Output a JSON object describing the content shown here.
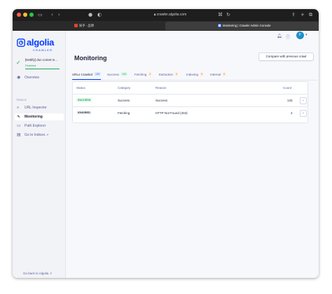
{
  "browser": {
    "url": "crawler.algolia.com",
    "tabs": [
      {
        "title": "知乎 - 品牌"
      },
      {
        "title": "Monitoring | Crawler Admin Console"
      }
    ]
  },
  "sidebar": {
    "logo_text": "algolia",
    "logo_subtitle": "CRAWLER",
    "crawler": {
      "name": "[Netlify] doc-comet m...",
      "status": "Finished"
    },
    "overview_label": "Overview",
    "tools_label": "TOOLS",
    "items": [
      {
        "label": "URL Inspector",
        "icon": "search-icon"
      },
      {
        "label": "Monitoring",
        "icon": "pulse-icon"
      },
      {
        "label": "Path Explorer",
        "icon": "folder-icon"
      },
      {
        "label": "Go to Indices",
        "icon": "external-link-icon"
      }
    ],
    "back_link": "Go back to Algolia"
  },
  "header": {
    "avatar_initial": "F"
  },
  "main": {
    "title": "Monitoring",
    "compare_button": "Compare with previous crawl",
    "tabs": [
      {
        "label": "URLs Crawled",
        "count": "135",
        "color": "blue"
      },
      {
        "label": "Success",
        "count": "133",
        "color": "green"
      },
      {
        "label": "Fetching",
        "count": "2",
        "color": "orange"
      },
      {
        "label": "Extraction",
        "count": "0",
        "color": "orange"
      },
      {
        "label": "Indexing",
        "count": "0",
        "color": "orange"
      },
      {
        "label": "Internal",
        "count": "0",
        "color": "orange"
      }
    ],
    "table": {
      "columns": [
        "Status",
        "Category",
        "Reason",
        "Count"
      ],
      "rows": [
        {
          "status": "SUCCESS",
          "category": "Success",
          "reason": "Success",
          "count": "133"
        },
        {
          "status": "IGNORED",
          "category": "Fetching",
          "reason": "HTTP Not Found (404)",
          "count": "2"
        }
      ]
    }
  },
  "colors": {
    "accent": "#003dff",
    "success": "#1fa35c",
    "text": "#23263b",
    "muted": "#5a5e9a"
  }
}
